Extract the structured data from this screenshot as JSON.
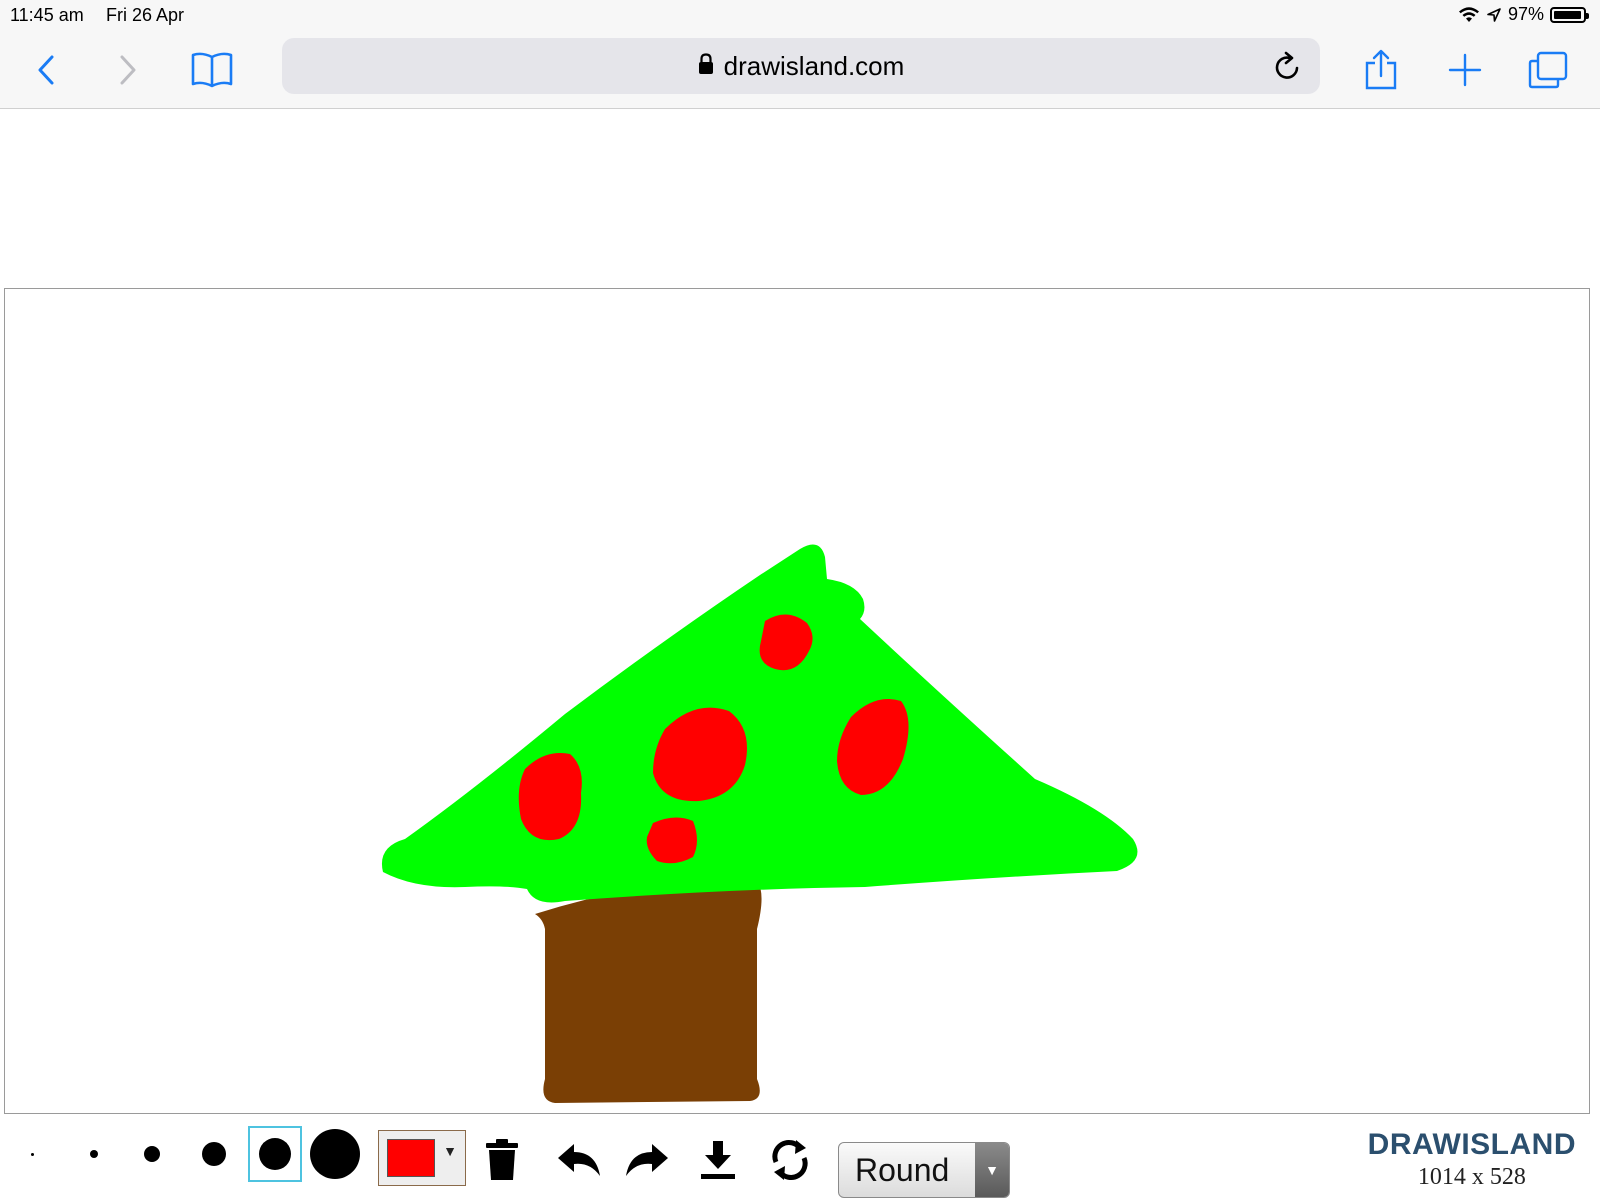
{
  "status_bar": {
    "time": "11:45 am",
    "date": "Fri 26 Apr",
    "battery_text": "97%",
    "battery_level": 0.97
  },
  "browser": {
    "url": "drawisland.com",
    "icons": [
      "back-icon",
      "forward-icon",
      "bookmarks-icon",
      "lock-icon",
      "reload-icon",
      "share-icon",
      "new-tab-icon",
      "tabs-icon"
    ]
  },
  "drawing": {
    "colors": {
      "leaves": "#00ff00",
      "trunk": "#7a3f05",
      "fruit": "#ff0000"
    }
  },
  "tools": {
    "brush_sizes": [
      "tiny",
      "small",
      "medium",
      "large",
      "x-large",
      "xx-large"
    ],
    "selected_brush": "x-large",
    "selected_color": "#ff0000",
    "cap_style": "Round"
  },
  "brand": {
    "name": "DRAWISLAND",
    "canvas_size": "1014 x 528"
  }
}
